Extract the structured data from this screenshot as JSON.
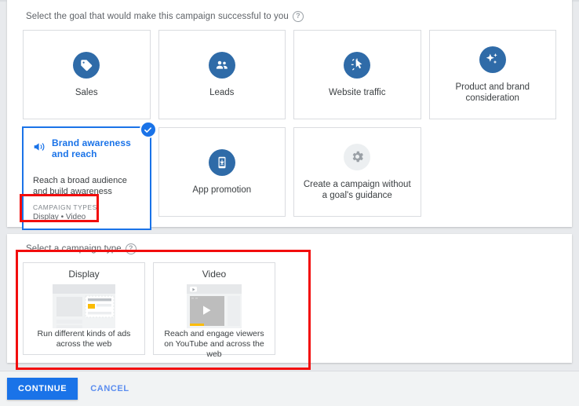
{
  "goal_section": {
    "label": "Select the goal that would make this campaign successful to you",
    "help_icon": "help-icon",
    "cards": [
      {
        "label": "Sales",
        "icon": "tag-icon"
      },
      {
        "label": "Leads",
        "icon": "people-icon"
      },
      {
        "label": "Website traffic",
        "icon": "cursor-click-icon"
      },
      {
        "label": "Product and brand consideration",
        "icon": "sparkle-icon"
      },
      {
        "label": "App promotion",
        "icon": "mobile-download-icon"
      },
      {
        "label": "Create a campaign without a goal's guidance",
        "icon": "gear-icon"
      }
    ],
    "selected_card": {
      "title": "Brand awareness and reach",
      "icon": "megaphone-icon",
      "description": "Reach a broad audience and build awareness",
      "campaign_types_label": "CAMPAIGN TYPES",
      "campaign_types_value": "Display • Video",
      "check_icon": "check-circle-icon",
      "selected": true
    }
  },
  "type_section": {
    "label": "Select a campaign type",
    "help_icon": "help-icon",
    "cards": [
      {
        "title": "Display",
        "description": "Run different kinds of ads across the web",
        "thumb": "display-ad-thumbnail"
      },
      {
        "title": "Video",
        "description": "Reach and engage viewers on YouTube and across the web",
        "thumb": "video-player-thumbnail"
      }
    ]
  },
  "footer": {
    "continue_label": "CONTINUE",
    "cancel_label": "CANCEL"
  },
  "colors": {
    "accent_blue": "#1a73e8",
    "icon_blue": "#2f6ba8",
    "annotation_red": "#f20d0d",
    "page_bg": "#e8eaed",
    "footer_bg": "#f1f3f4",
    "yellow_accent": "#fbbc04"
  }
}
